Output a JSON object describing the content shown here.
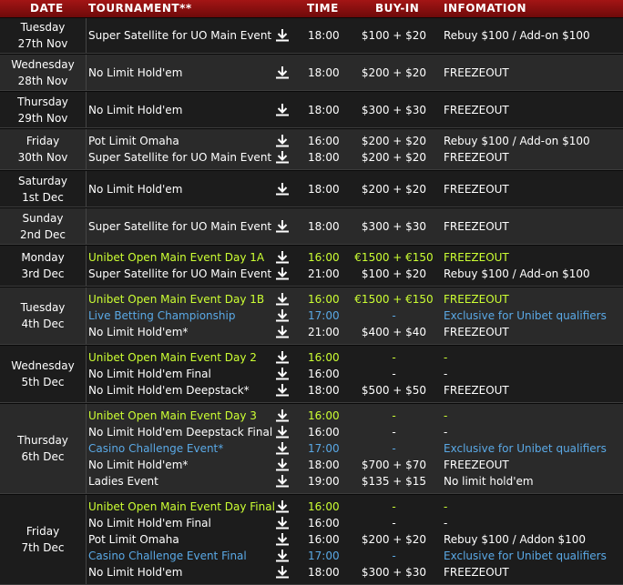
{
  "header": {
    "date": "DATE",
    "tournament": "TOURNAMENT**",
    "time": "TIME",
    "buyin": "BUY-IN",
    "info": "INFOMATION"
  },
  "icons": {
    "download": "download-arrow-icon"
  },
  "colors": {
    "green": "#ccff33",
    "blue": "#5aa9e6",
    "white": "#ffffff",
    "header": "#a31515"
  },
  "schedule": [
    {
      "day": "Tuesday",
      "date": "27th Nov",
      "events": [
        {
          "name": "Super Satellite for UO Main Event",
          "time": "18:00",
          "buyin": "$100 + $20",
          "info": "Rebuy $100 / Add-on $100",
          "color": "white"
        }
      ]
    },
    {
      "day": "Wednesday",
      "date": "28th Nov",
      "events": [
        {
          "name": "No Limit Hold'em",
          "time": "18:00",
          "buyin": "$200 + $20",
          "info": "FREEZEOUT",
          "color": "white"
        }
      ]
    },
    {
      "day": "Thursday",
      "date": "29th Nov",
      "events": [
        {
          "name": "No Limit Hold'em",
          "time": "18:00",
          "buyin": "$300 + $30",
          "info": "FREEZEOUT",
          "color": "white"
        }
      ]
    },
    {
      "day": "Friday",
      "date": "30th Nov",
      "events": [
        {
          "name": "Pot Limit Omaha",
          "time": "16:00",
          "buyin": "$200 + $20",
          "info": "Rebuy $100 / Add-on $100",
          "color": "white"
        },
        {
          "name": "Super Satellite for UO Main Event",
          "time": "18:00",
          "buyin": "$200 + $20",
          "info": "FREEZEOUT",
          "color": "white"
        }
      ]
    },
    {
      "day": "Saturday",
      "date": "1st Dec",
      "events": [
        {
          "name": "No Limit Hold'em",
          "time": "18:00",
          "buyin": "$200 + $20",
          "info": "FREEZEOUT",
          "color": "white"
        }
      ]
    },
    {
      "day": "Sunday",
      "date": "2nd Dec",
      "events": [
        {
          "name": "Super Satellite for UO Main Event",
          "time": "18:00",
          "buyin": "$300 + $30",
          "info": "FREEZEOUT",
          "color": "white"
        }
      ]
    },
    {
      "day": "Monday",
      "date": "3rd Dec",
      "events": [
        {
          "name": "Unibet Open Main Event Day 1A",
          "time": "16:00",
          "buyin": "€1500 + €150",
          "info": "FREEZEOUT",
          "color": "green"
        },
        {
          "name": "Super Satellite for UO Main Event",
          "time": "21:00",
          "buyin": "$100 + $20",
          "info": "Rebuy $100 / Add-on $100",
          "color": "white"
        }
      ]
    },
    {
      "day": "Tuesday",
      "date": "4th Dec",
      "events": [
        {
          "name": "Unibet Open Main Event Day 1B",
          "time": "16:00",
          "buyin": "€1500 + €150",
          "info": "FREEZEOUT",
          "color": "green"
        },
        {
          "name": "Live Betting Championship",
          "time": "17:00",
          "buyin": "-",
          "info": "Exclusive for Unibet qualifiers",
          "color": "blue"
        },
        {
          "name": "No Limit Hold'em*",
          "time": "21:00",
          "buyin": "$400 + $40",
          "info": "FREEZEOUT",
          "color": "white"
        }
      ]
    },
    {
      "day": "Wednesday",
      "date": "5th Dec",
      "events": [
        {
          "name": "Unibet Open Main Event Day 2",
          "time": "16:00",
          "buyin": "-",
          "info": "-",
          "color": "green"
        },
        {
          "name": "No Limit Hold'em Final",
          "time": "16:00",
          "buyin": "-",
          "info": "-",
          "color": "white"
        },
        {
          "name": "No Limit Hold'em Deepstack*",
          "time": "18:00",
          "buyin": "$500 + $50",
          "info": "FREEZEOUT",
          "color": "white"
        }
      ]
    },
    {
      "day": "Thursday",
      "date": "6th Dec",
      "events": [
        {
          "name": "Unibet Open Main Event Day 3",
          "time": "16:00",
          "buyin": "-",
          "info": "-",
          "color": "green"
        },
        {
          "name": "No Limit Hold'em Deepstack Final",
          "time": "16:00",
          "buyin": "-",
          "info": "-",
          "color": "white"
        },
        {
          "name": "Casino Challenge Event*",
          "time": "17:00",
          "buyin": "-",
          "info": "Exclusive for Unibet qualifiers",
          "color": "blue"
        },
        {
          "name": "No Limit Hold'em*",
          "time": "18:00",
          "buyin": "$700 + $70",
          "info": "FREEZEOUT",
          "color": "white"
        },
        {
          "name": "Ladies Event",
          "time": "19:00",
          "buyin": "$135 + $15",
          "info": "No limit hold'em",
          "color": "white"
        }
      ]
    },
    {
      "day": "Friday",
      "date": "7th Dec",
      "events": [
        {
          "name": "Unibet Open Main Event Day Final",
          "time": "16:00",
          "buyin": "-",
          "info": "-",
          "color": "green"
        },
        {
          "name": "No Limit Hold'em Final",
          "time": "16:00",
          "buyin": "-",
          "info": "-",
          "color": "white"
        },
        {
          "name": "Pot Limit Omaha",
          "time": "16:00",
          "buyin": "$200 + $20",
          "info": "Rebuy $100 / Addon $100",
          "color": "white"
        },
        {
          "name": "Casino Challenge Event Final",
          "time": "17:00",
          "buyin": "-",
          "info": "Exclusive for Unibet qualifiers",
          "color": "blue"
        },
        {
          "name": "No Limit Hold'em",
          "time": "18:00",
          "buyin": "$300 + $30",
          "info": "FREEZEOUT",
          "color": "white"
        }
      ]
    }
  ]
}
